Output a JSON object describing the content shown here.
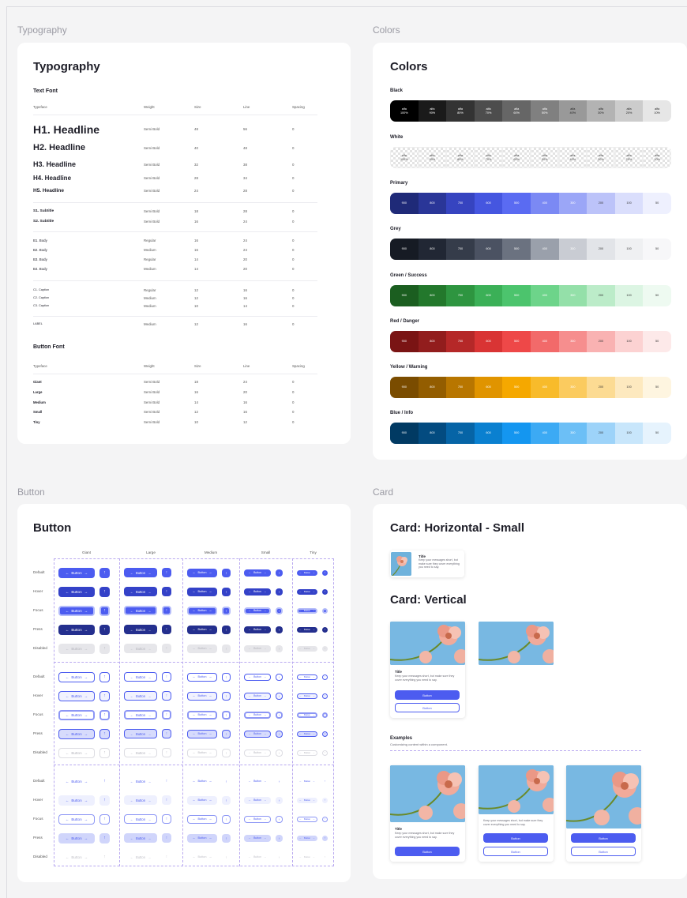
{
  "sections": {
    "typography": "Typography",
    "colors": "Colors",
    "button": "Button",
    "card": "Card"
  },
  "typography": {
    "title": "Typography",
    "text_font": "Text Font",
    "button_font": "Button Font",
    "headers": [
      "Typeface",
      "Weight",
      "Size",
      "Line",
      "Spacing"
    ],
    "headlines": [
      {
        "name": "H1. Headline",
        "weight": "Semi Bold",
        "size": "48",
        "line": "56",
        "spacing": "0"
      },
      {
        "name": "H2. Headline",
        "weight": "Semi Bold",
        "size": "40",
        "line": "48",
        "spacing": "0"
      },
      {
        "name": "H3. Headline",
        "weight": "Semi Bold",
        "size": "32",
        "line": "38",
        "spacing": "0"
      },
      {
        "name": "H4. Headline",
        "weight": "Semi Bold",
        "size": "28",
        "line": "34",
        "spacing": "0"
      },
      {
        "name": "H5. Headline",
        "weight": "Semi Bold",
        "size": "24",
        "line": "28",
        "spacing": "0"
      }
    ],
    "subtitles": [
      {
        "name": "S1. Subtitle",
        "weight": "Semi Bold",
        "size": "18",
        "line": "28",
        "spacing": "0"
      },
      {
        "name": "S2. Subtitle",
        "weight": "Semi Bold",
        "size": "16",
        "line": "24",
        "spacing": "0"
      }
    ],
    "bodies": [
      {
        "name": "B1. Body",
        "weight": "Regular",
        "size": "16",
        "line": "24",
        "spacing": "0"
      },
      {
        "name": "B2. Body",
        "weight": "Medium",
        "size": "16",
        "line": "24",
        "spacing": "0"
      },
      {
        "name": "B3. Body",
        "weight": "Regular",
        "size": "14",
        "line": "20",
        "spacing": "0"
      },
      {
        "name": "B4. Body",
        "weight": "Medium",
        "size": "14",
        "line": "20",
        "spacing": "0"
      }
    ],
    "captions": [
      {
        "name": "C1. Caption",
        "weight": "Regular",
        "size": "12",
        "line": "16",
        "spacing": "0"
      },
      {
        "name": "C2. Caption",
        "weight": "Medium",
        "size": "12",
        "line": "16",
        "spacing": "0"
      },
      {
        "name": "C3. Caption",
        "weight": "Medium",
        "size": "10",
        "line": "14",
        "spacing": "0"
      }
    ],
    "label": {
      "name": "LABEL",
      "weight": "Medium",
      "size": "12",
      "line": "16",
      "spacing": "0"
    },
    "button_fonts": [
      {
        "name": "Giant",
        "weight": "Semi Bold",
        "size": "18",
        "line": "24",
        "spacing": "0"
      },
      {
        "name": "Large",
        "weight": "Semi Bold",
        "size": "16",
        "line": "20",
        "spacing": "0"
      },
      {
        "name": "Medium",
        "weight": "Semi Bold",
        "size": "14",
        "line": "16",
        "spacing": "0"
      },
      {
        "name": "Small",
        "weight": "Semi Bold",
        "size": "12",
        "line": "16",
        "spacing": "0"
      },
      {
        "name": "Tiny",
        "weight": "Semi Bold",
        "size": "10",
        "line": "12",
        "spacing": "0"
      }
    ]
  },
  "colors": {
    "title": "Colors",
    "alpha_labels": [
      "alfa\n100%",
      "alfa\n90%",
      "alfa\n80%",
      "alfa\n70%",
      "alfa\n60%",
      "alfa\n50%",
      "alfa\n40%",
      "alfa\n30%",
      "alfa\n20%",
      "alfa\n10%"
    ],
    "shade_labels": [
      "900",
      "800",
      "700",
      "600",
      "500",
      "400",
      "300",
      "200",
      "100",
      "50"
    ],
    "palettes": [
      {
        "name": "Black",
        "kind": "alpha-black",
        "swatches": [
          "#000000",
          "#1a1a1a",
          "#333333",
          "#4d4d4d",
          "#666666",
          "#808080",
          "#999999",
          "#b3b3b3",
          "#cccccc",
          "#e6e6e6"
        ]
      },
      {
        "name": "White",
        "kind": "alpha-white",
        "swatches": []
      },
      {
        "name": "Primary",
        "kind": "shade",
        "swatches": [
          "#1f2a78",
          "#2a3698",
          "#3644c0",
          "#4556e0",
          "#5a6bf2",
          "#7b89f4",
          "#9ba6f7",
          "#bcc3f9",
          "#dadefc",
          "#eef0fe"
        ]
      },
      {
        "name": "Grey",
        "kind": "shade",
        "swatches": [
          "#161b24",
          "#212734",
          "#353c4a",
          "#4b5262",
          "#6b7280",
          "#9aa0ab",
          "#c9ccd3",
          "#e2e4e8",
          "#eff0f2",
          "#f7f7f9"
        ]
      },
      {
        "name": "Green / Success",
        "kind": "shade",
        "swatches": [
          "#1b5e20",
          "#23782c",
          "#2e9540",
          "#3bb057",
          "#4cc46d",
          "#6dd48a",
          "#94e0a9",
          "#bcecc9",
          "#dcf5e3",
          "#eefaf1"
        ]
      },
      {
        "name": "Red / Danger",
        "kind": "shade",
        "swatches": [
          "#7a1414",
          "#921d1d",
          "#b52828",
          "#d93434",
          "#ee4848",
          "#f26a6a",
          "#f68e8e",
          "#f9b2b2",
          "#fcd2d2",
          "#fde9e9"
        ]
      },
      {
        "name": "Yellow / Warning",
        "kind": "shade",
        "swatches": [
          "#7a4c00",
          "#935d00",
          "#b87600",
          "#e09400",
          "#f5a800",
          "#f8bb2b",
          "#fbcb5f",
          "#fcdb93",
          "#fde9bf",
          "#fef5e0"
        ]
      },
      {
        "name": "Blue / Info",
        "kind": "shade",
        "swatches": [
          "#013a63",
          "#034b80",
          "#0664a6",
          "#0a80d0",
          "#1496f0",
          "#3caaf4",
          "#6cbff6",
          "#9dd3f9",
          "#c8e6fb",
          "#e6f3fd"
        ]
      }
    ]
  },
  "button": {
    "title": "Button",
    "columns": [
      "Giant",
      "Large",
      "Medium",
      "Small",
      "Tiny"
    ],
    "states": [
      "Default",
      "Hover",
      "Focus",
      "Press",
      "Disabled"
    ],
    "label": "Button",
    "arrow_left": "←",
    "arrow_right": "→",
    "arrow_up": "↑"
  },
  "card": {
    "horizontal_title": "Card: Horizontal - Small",
    "vertical_title": "Card: Vertical",
    "card_title": "Title",
    "h_text": "Keep your messages short, but make sure they cover everything you need to say.",
    "v_text": "Keep your messages short, but make sure they cover everything you need to say.",
    "button": "Button",
    "examples_title": "Examples",
    "examples_sub": "Customizing content within a component."
  }
}
